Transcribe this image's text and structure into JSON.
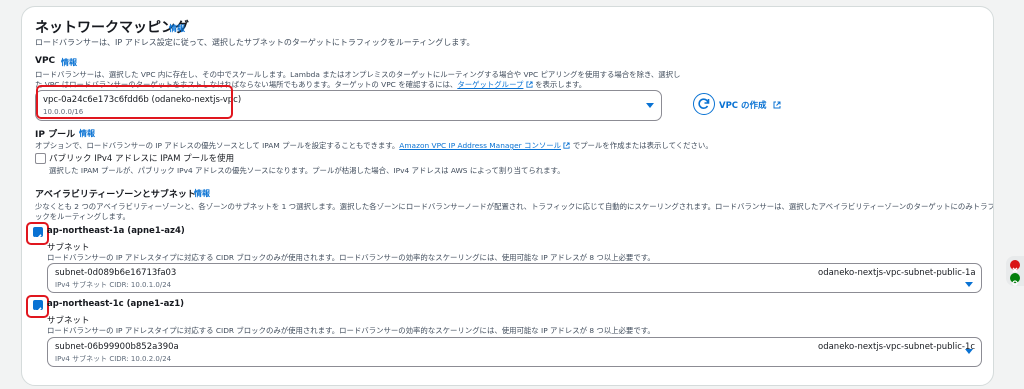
{
  "network": {
    "title": "ネットワークマッピング",
    "info": "情報",
    "description": "ロードバランサーは、IP アドレス設定に従って、選択したサブネットのターゲットにトラフィックをルーティングします。"
  },
  "vpc": {
    "label": "VPC",
    "info": "情報",
    "desc_line1": "ロードバランサーは、選択した VPC 内に存在し、その中でスケールします。Lambda またはオンプレミスのターゲットにルーティングする場合や VPC ピアリングを使用する場合を除き、選択し",
    "desc_line2_pre": "た VPC はロードバランサーのターゲットをホストしなければならない場所でもあります。ターゲットの VPC を確認するには、",
    "desc_link": "ターゲットグループ",
    "desc_line2_post": "を表示します。",
    "selected_value": "vpc-0a24c6e173c6fdd6b (odaneko-nextjs-vpc)",
    "selected_cidr": "10.0.0.0/16",
    "create_label": "VPC の作成"
  },
  "ip_pool": {
    "label": "IP プール",
    "info": "情報",
    "desc_pre": "オプションで、ロードバランサーの IP アドレスの優先ソースとして IPAM プールを設定することもできます。",
    "desc_link": "Amazon VPC IP Address Manager コンソール",
    "desc_post": "でプールを作成または表示してください。",
    "checkbox_label": "パブリック IPv4 アドレスに IPAM プールを使用",
    "checkbox_desc": "選択した IPAM プールが、パブリック IPv4 アドレスの優先ソースになります。プールが枯渇した場合、IPv4 アドレスは AWS によって割り当てられます。"
  },
  "az": {
    "label": "アベイラビリティーゾーンとサブネット",
    "info": "情報",
    "desc_line1": "少なくとも 2 つのアベイラビリティーゾーンと、各ゾーンのサブネットを 1 つ選択します。選択した各ゾーンにロードバランサーノードが配置され、トラフィックに応じて自動的にスケーリングされます。ロードバランサーは、選択したアベイラビリティーゾーンのターゲットにのみトラフィ",
    "desc_line2": "ックをルーティングします。",
    "zones": [
      {
        "name": "ap-northeast-1a (apne1-az4)",
        "subnet_label": "サブネット",
        "subnet_desc": "ロードバランサーの IP アドレスタイプに対応する CIDR ブロックのみが使用されます。ロードバランサーの効率的なスケーリングには、使用可能な IP アドレスが 8 つ以上必要です。",
        "subnet_id": "subnet-0d089b6e16713fa03",
        "subnet_cidr": "IPv4 サブネット CIDR: 10.0.1.0/24",
        "subnet_name": "odaneko-nextjs-vpc-subnet-public-1a"
      },
      {
        "name": "ap-northeast-1c (apne1-az1)",
        "subnet_label": "サブネット",
        "subnet_desc": "ロードバランサーの IP アドレスタイプに対応する CIDR ブロックのみが使用されます。ロードバランサーの効率的なスケーリングには、使用可能な IP アドレスが 8 つ以上必要です。",
        "subnet_id": "subnet-06b99900b852a390a",
        "subnet_cidr": "IPv4 サブネット CIDR: 10.0.2.0/24",
        "subnet_name": "odaneko-nextjs-vpc-subnet-public-1c"
      }
    ]
  },
  "colors": {
    "accent": "#0972d3",
    "highlight": "#e0161e",
    "side_red": "#d91515",
    "side_green": "#037f0c"
  }
}
